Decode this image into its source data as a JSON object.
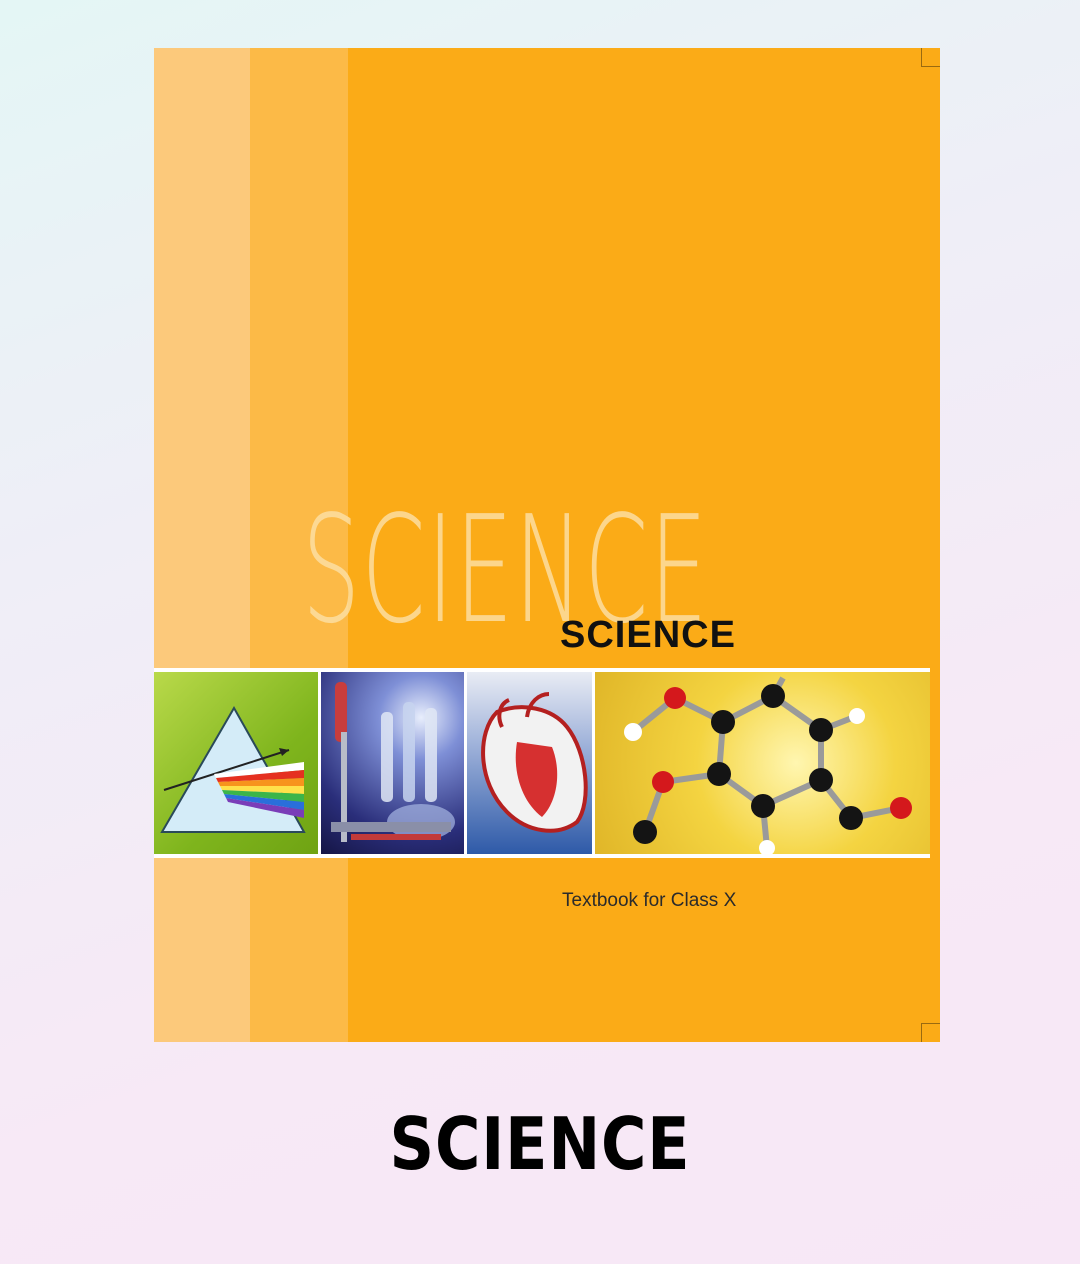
{
  "cover": {
    "background_title": "SCIENCE",
    "title": "SCIENCE",
    "subtitle": "Textbook for Class X",
    "colors": {
      "cover_orange": "#fbab17",
      "stripe_light": "#fcc97b",
      "stripe_mid": "#fcba47"
    },
    "images": [
      "prism-image",
      "lab-apparatus-image",
      "heart-image",
      "molecule-image"
    ]
  },
  "caption": "SCIENCE"
}
